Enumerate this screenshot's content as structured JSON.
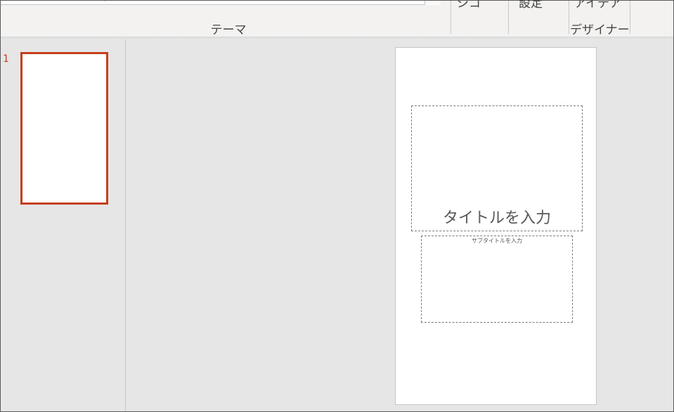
{
  "ribbon": {
    "group_label": "テーマ",
    "buttons": [
      {
        "label": "シコ"
      },
      {
        "label": "設定"
      },
      {
        "label_top": "アイデア",
        "label_bottom": "デザイナー"
      }
    ]
  },
  "thumbnails": [
    {
      "number": "1",
      "selected": true
    }
  ],
  "slide": {
    "title_placeholder": "タイトルを入力",
    "subtitle_placeholder": "サブタイトルを入力"
  },
  "colors": {
    "accent": "#c43e1c",
    "ribbon_bg": "#f3f2f1",
    "workspace_bg": "#e6e6e6"
  }
}
